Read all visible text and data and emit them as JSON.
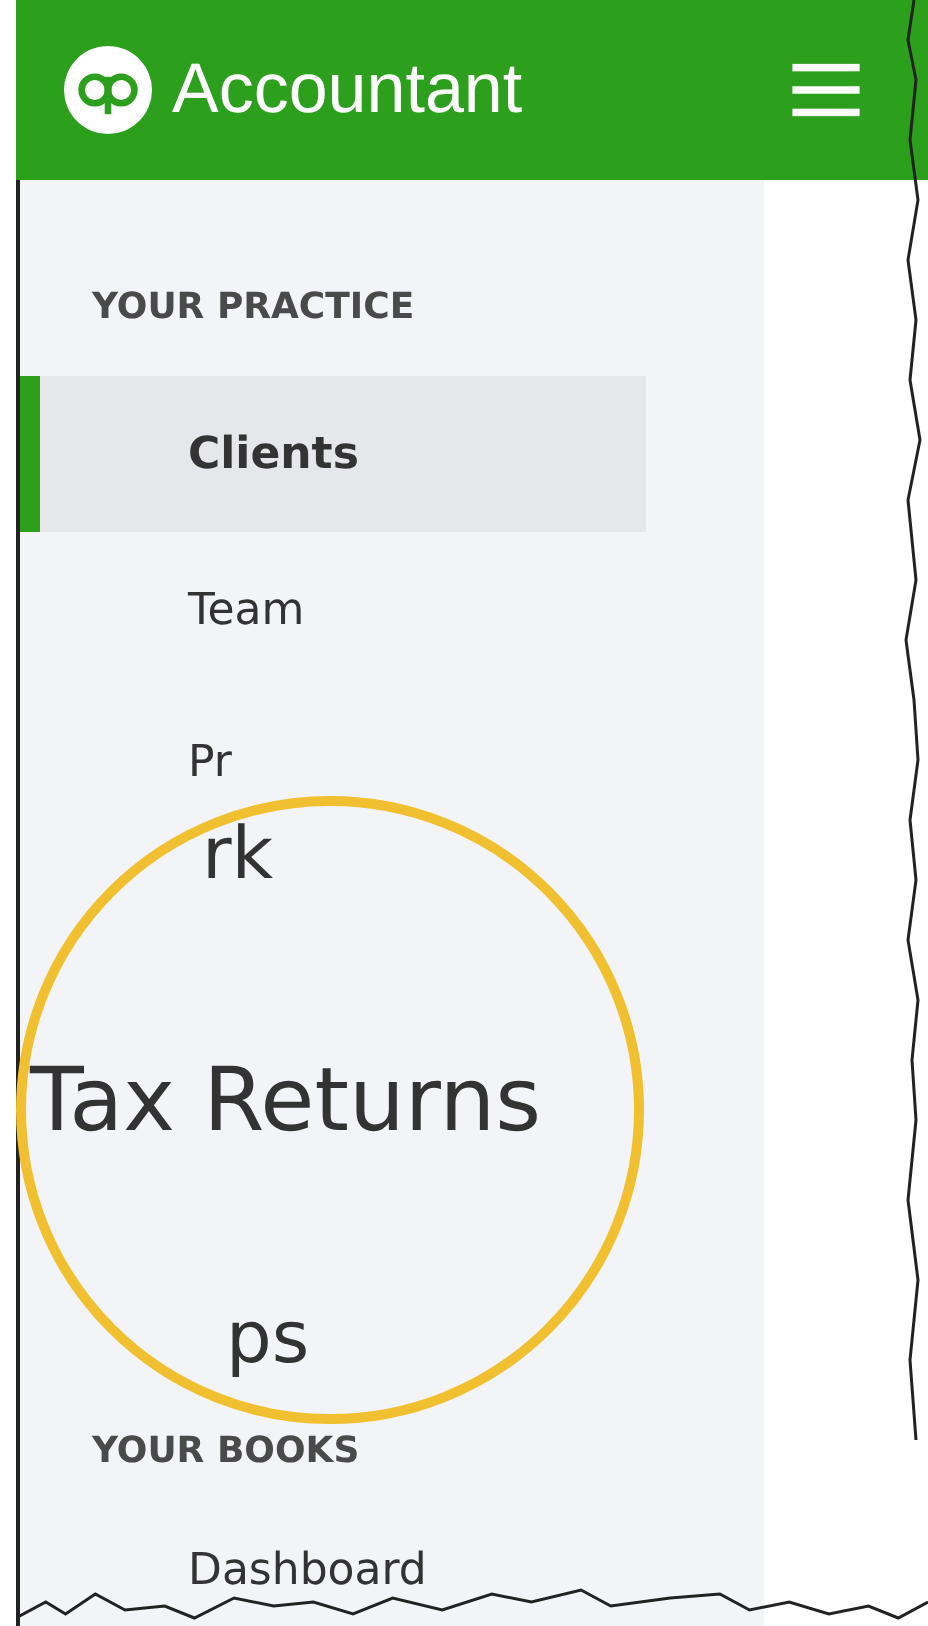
{
  "header": {
    "title": "Accountant"
  },
  "sidebar": {
    "sections": [
      {
        "heading": "YOUR PRACTICE",
        "items": [
          {
            "label": "Clients",
            "selected": true
          },
          {
            "label": "Team",
            "selected": false
          },
          {
            "label": "Pr",
            "selected": false
          }
        ]
      },
      {
        "heading": "YOUR BOOKS",
        "items": [
          {
            "label": "Dashboard",
            "selected": false
          }
        ]
      }
    ]
  },
  "magnifier": {
    "texts": [
      {
        "kind": "partial",
        "text": "rk"
      },
      {
        "kind": "main",
        "text": "Tax Returns"
      },
      {
        "kind": "partial",
        "text": "ps"
      }
    ]
  }
}
